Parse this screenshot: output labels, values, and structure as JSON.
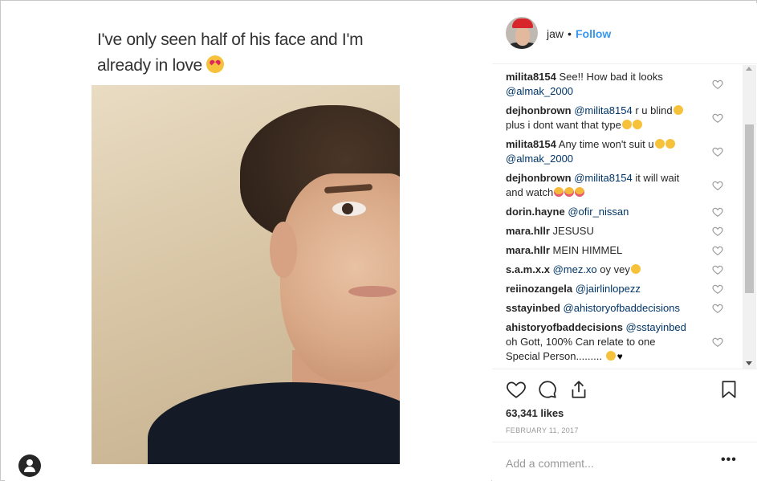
{
  "post": {
    "meme_caption": "I've only seen half of his face and I'm already in love",
    "username": "jaw",
    "follow_dot": "•",
    "follow_label": "Follow",
    "likes": "63,341 likes",
    "date": "FEBRUARY 11, 2017",
    "add_comment_placeholder": "Add a comment...",
    "more_label": "•••"
  },
  "comments": [
    {
      "user": "milita8154",
      "text": "See!! How bad it looks",
      "mention_after": "@almak_2000",
      "emoji": ""
    },
    {
      "user": "dejhonbrown",
      "mention": "@milita8154",
      "text": "r u blind",
      "text2": "plus i dont want that type",
      "emoji": "laugh"
    },
    {
      "user": "milita8154",
      "text": "Any time won't suit u",
      "mention_after": "@almak_2000",
      "emoji": "laugh"
    },
    {
      "user": "dejhonbrown",
      "mention": "@milita8154",
      "text": "it will wait",
      "text2": "and watch",
      "emoji": "tongue"
    },
    {
      "user": "dorin.hayne",
      "mention": "@ofir_nissan",
      "text": ""
    },
    {
      "user": "mara.hllr",
      "text": "JESUSU"
    },
    {
      "user": "mara.hllr",
      "text": "MEIN HIMMEL"
    },
    {
      "user": "s.a.m.x.x",
      "mention": "@mez.xo",
      "text": "oy vey"
    },
    {
      "user": "reiinozangela",
      "mention": "@jairlinlopezz",
      "text": ""
    },
    {
      "user": "sstayinbed",
      "mention": "@ahistoryofbaddecisions",
      "text": ""
    },
    {
      "user": "ahistoryofbaddecisions",
      "mention": "@sstayinbed",
      "text": "oh Gott, 100% Can relate to one",
      "text2": "Special Person........."
    }
  ],
  "icons": [
    "user-circle-icon",
    "heart-icon",
    "comment-icon",
    "share-icon",
    "bookmark-icon"
  ],
  "colors": {
    "accent": "#3897f0",
    "mention": "#003569",
    "border": "#efefef",
    "muted": "#999999"
  }
}
